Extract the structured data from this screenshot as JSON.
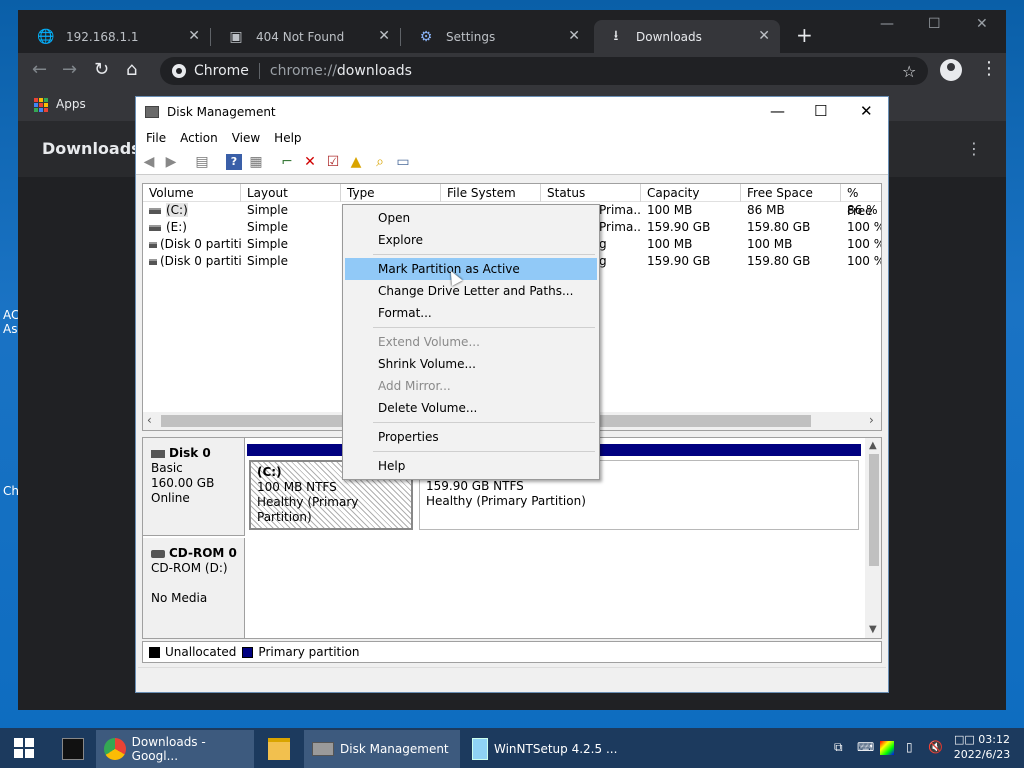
{
  "desktop": {
    "left_text_1": "AC",
    "left_text_2": "As",
    "left_text_3": "Ch"
  },
  "browser": {
    "tabs": [
      {
        "label": "192.168.1.1",
        "icon": "globe-icon"
      },
      {
        "label": "404 Not Found",
        "icon": "server-icon"
      },
      {
        "label": "Settings",
        "icon": "gear-icon"
      },
      {
        "label": "Downloads",
        "icon": "download-icon"
      }
    ],
    "site_chip": "Chrome",
    "url_scheme": "chrome://",
    "url_host": "downloads",
    "bookmarks_apps": "Apps",
    "page_title": "Downloads"
  },
  "disk_mgmt": {
    "title": "Disk Management",
    "menu": [
      "File",
      "Action",
      "View",
      "Help"
    ],
    "columns": [
      "Volume",
      "Layout",
      "Type",
      "File System",
      "Status",
      "Capacity",
      "Free Space",
      "% Free"
    ],
    "volumes": [
      {
        "volume": "(C:)",
        "layout": "Simple",
        "status": "Prima...",
        "capacity": "100 MB",
        "free": "86 MB",
        "pct": "86 %"
      },
      {
        "volume": "(E:)",
        "layout": "Simple",
        "status": "Prima...",
        "capacity": "159.90 GB",
        "free": "159.80 GB",
        "pct": "100 %"
      },
      {
        "volume": "(Disk 0 partiti...",
        "layout": "Simple",
        "status": "g",
        "capacity": "100 MB",
        "free": "100 MB",
        "pct": "100 %"
      },
      {
        "volume": "(Disk 0 partiti...",
        "layout": "Simple",
        "status": "g",
        "capacity": "159.90 GB",
        "free": "159.80 GB",
        "pct": "100 %"
      }
    ],
    "disk0": {
      "name": "Disk 0",
      "type": "Basic",
      "size": "160.00 GB",
      "state": "Online"
    },
    "part_c": {
      "name": "(C:)",
      "size": "100 MB NTFS",
      "health": "Healthy (Primary Partition)"
    },
    "part_e": {
      "size": "159.90 GB NTFS",
      "health": "Healthy (Primary Partition)"
    },
    "cdrom": {
      "name": "CD-ROM 0",
      "drive": "CD-ROM (D:)",
      "media": "No Media"
    },
    "legend": {
      "unallocated": "Unallocated",
      "primary": "Primary partition",
      "unallocated_color": "#000000",
      "primary_color": "#000080"
    }
  },
  "context_menu": {
    "open": "Open",
    "explore": "Explore",
    "mark_active": "Mark Partition as Active",
    "change_letter": "Change Drive Letter and Paths...",
    "format": "Format...",
    "extend": "Extend Volume...",
    "shrink": "Shrink Volume...",
    "add_mirror": "Add Mirror...",
    "delete": "Delete Volume...",
    "properties": "Properties",
    "help": "Help"
  },
  "taskbar": {
    "chrome_label": "Downloads - Googl...",
    "diskmgmt_label": "Disk Management",
    "winntsetup_label": "WinNTSetup 4.2.5   ...",
    "time": "03:12",
    "date": "2022/6/23",
    "period": "□□"
  }
}
